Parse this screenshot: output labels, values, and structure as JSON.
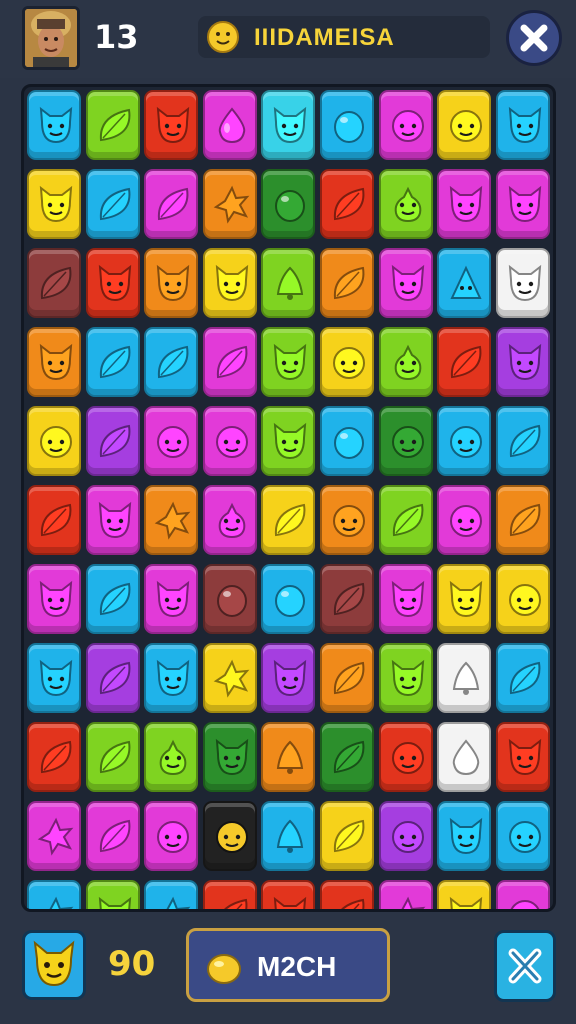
{
  "header": {
    "level": "13",
    "title": "IIIDAMEISA"
  },
  "footer": {
    "score": "90",
    "action_label": "M2CH"
  },
  "colors": {
    "bg": "#2b3445",
    "accent_yellow": "#f5d33c",
    "button_blue": "#3a4a86",
    "button_border": "#c9a042"
  },
  "grid_colors": {
    "C": "#1fb3ea",
    "Y": "#f6d21a",
    "R": "#e2341d",
    "M": "#e23ad8",
    "G": "#7fd321",
    "O": "#f08a1a",
    "P": "#a53ee0",
    "B": "#8d3c3c",
    "W": "#f3f3f3",
    "K": "#222222",
    "T": "#38d2e8",
    "D": "#2c8f2c"
  },
  "grid": [
    [
      "C:cat",
      "G:leaf",
      "R:cat",
      "M:drop",
      "T:cat",
      "C:berry",
      "M:blob",
      "Y:blob",
      "C:cat"
    ],
    [
      "Y:cat",
      "C:leaf",
      "M:leaf",
      "O:star",
      "D:berry",
      "R:leaf",
      "G:pear",
      "M:cat",
      "M:cat"
    ],
    [
      "B:leaf",
      "R:cat",
      "O:cat",
      "Y:cat",
      "G:bell",
      "O:leaf",
      "M:cat",
      "C:cone",
      "W:cat"
    ],
    [
      "O:cat",
      "C:leaf",
      "C:leaf",
      "M:leaf",
      "G:cat",
      "Y:blob",
      "G:pear",
      "R:leaf",
      "P:cat"
    ],
    [
      "Y:blob",
      "P:leaf",
      "M:blob",
      "M:blob",
      "G:cat",
      "C:berry",
      "D:blob",
      "C:blob",
      "C:leaf"
    ],
    [
      "R:leaf",
      "M:cat",
      "O:star",
      "M:pear",
      "Y:leaf",
      "O:blob",
      "G:leaf",
      "M:blob",
      "O:leaf"
    ],
    [
      "M:cat",
      "C:leaf",
      "M:cat",
      "B:berry",
      "C:berry",
      "B:leaf",
      "M:cat",
      "Y:cat",
      "Y:blob"
    ],
    [
      "C:cat",
      "P:leaf",
      "C:cat",
      "Y:star",
      "P:cat",
      "O:leaf",
      "G:cat",
      "W:bell",
      "C:leaf"
    ],
    [
      "R:leaf",
      "G:leaf",
      "G:pear",
      "D:cat",
      "O:bell",
      "D:leaf",
      "R:blob",
      "W:drop",
      "R:cat"
    ],
    [
      "M:star",
      "M:leaf",
      "M:blob",
      "K:blob",
      "C:bell",
      "Y:leaf",
      "P:blob",
      "C:cat",
      "C:blob"
    ],
    [
      "C:star",
      "G:cat",
      "C:star",
      "R:leaf",
      "R:cat",
      "R:leaf",
      "M:star",
      "Y:cat",
      "M:blob"
    ]
  ]
}
